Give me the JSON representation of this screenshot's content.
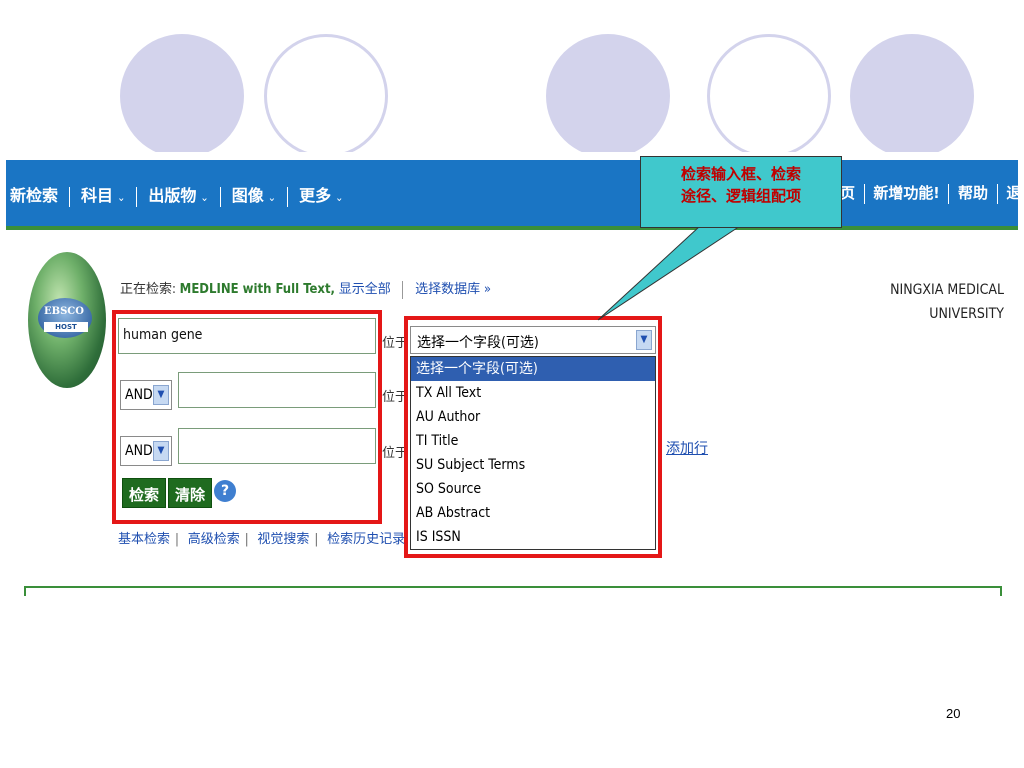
{
  "nav": {
    "items": [
      "新检索",
      "科目",
      "出版物",
      "图像",
      "更多"
    ],
    "right_items": [
      "页",
      "新增功能!",
      "帮助",
      "退出"
    ]
  },
  "searching": {
    "prefix": "正在检索:",
    "database": "MEDLINE with Full Text,",
    "show_all": "显示全部",
    "choose_db": "选择数据库 »"
  },
  "institution": {
    "line1": "NINGXIA MEDICAL",
    "line2": "UNIVERSITY"
  },
  "logo": {
    "text": "EBSCO",
    "sub": "HOST"
  },
  "search": {
    "rows": [
      {
        "value": "human gene",
        "bool": null,
        "in_label": "位于"
      },
      {
        "value": "",
        "bool": "AND",
        "in_label": "位于"
      },
      {
        "value": "",
        "bool": "AND",
        "in_label": "位于"
      }
    ],
    "field_select_value": "选择一个字段(可选)",
    "field_options": [
      "选择一个字段(可选)",
      "TX All Text",
      "AU Author",
      "TI Title",
      "SU Subject Terms",
      "SO Source",
      "AB Abstract",
      "IS ISSN"
    ],
    "add_row": "添加行",
    "search_button": "检索",
    "clear_button": "清除",
    "help": "?"
  },
  "links": [
    "基本检索",
    "高级检索",
    "视觉搜索",
    "检索历史记录"
  ],
  "callout": {
    "line1": "检索输入框、检索",
    "line2": "途径、逻辑组配项"
  },
  "colors": {
    "nav_bar": "#1a75c4",
    "highlight_red": "#e41717",
    "callout_bg": "#40c8cc",
    "callout_text": "#c00000",
    "decor_circle": "#d3d3ec",
    "button_green": "#1f6b1f"
  },
  "page_number": "20"
}
